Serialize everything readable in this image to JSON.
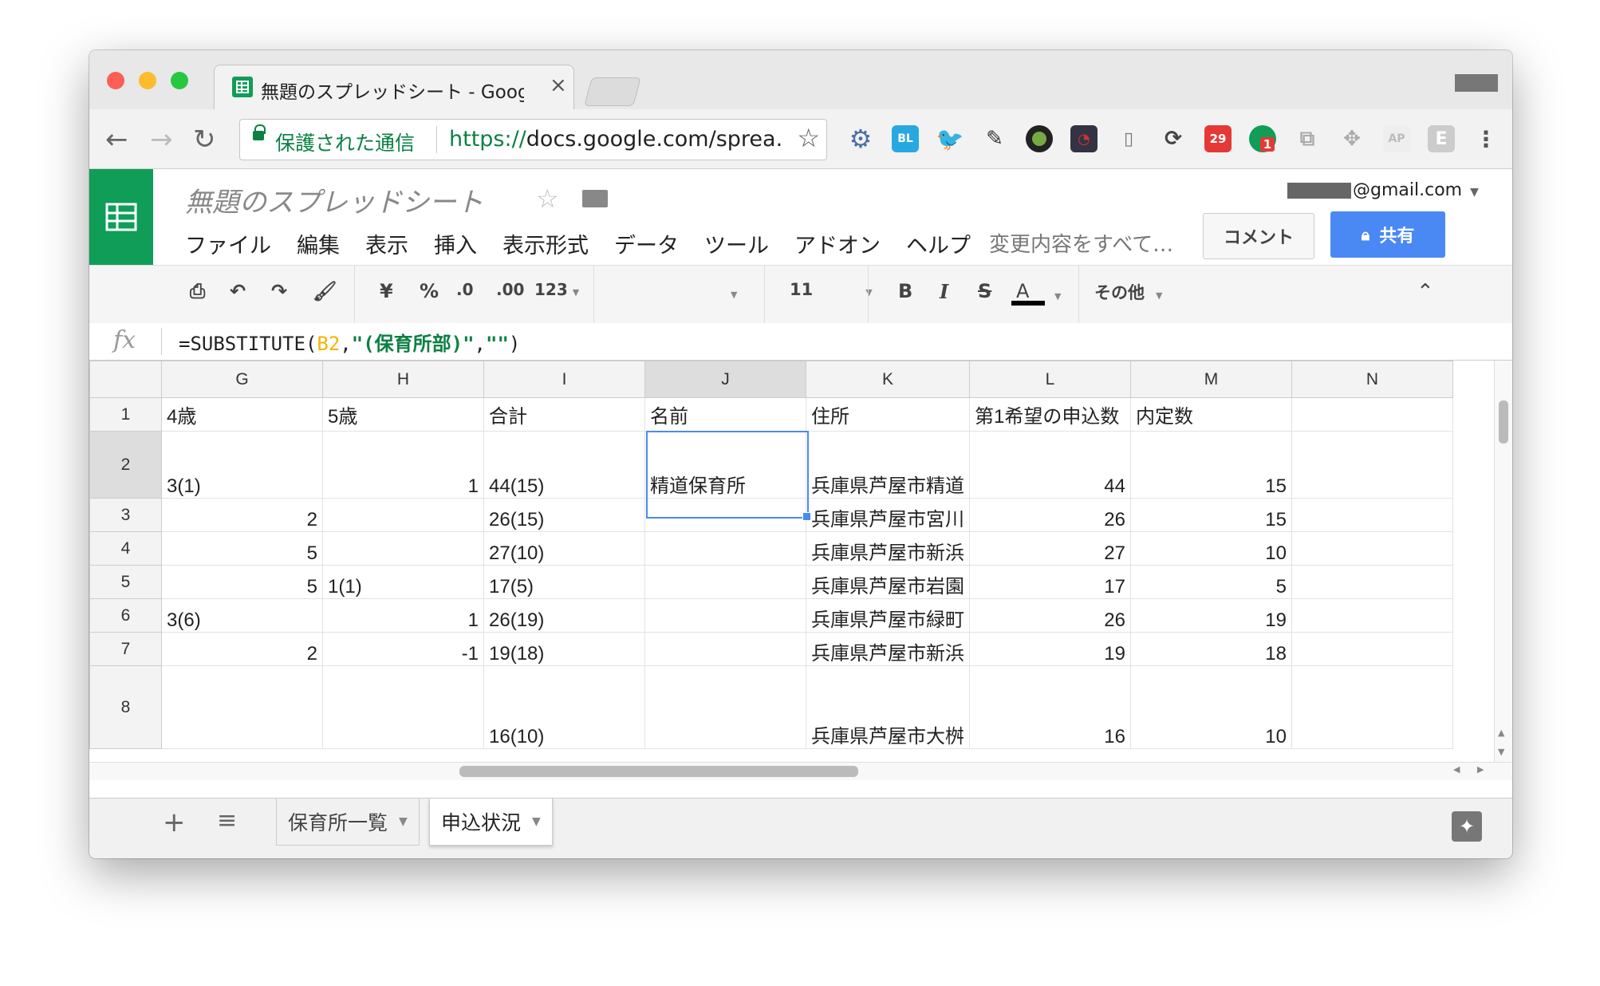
{
  "browser": {
    "tab_title": "無題のスプレッドシート - Google",
    "secure_label": "保護された通信",
    "url_scheme": "https://",
    "url_rest": "docs.google.com/sprea...",
    "ext_badge_calendar": "29",
    "ext_badge_green": "1",
    "ext_ap": "AP",
    "ext_e": "E",
    "ext_bl": "BL"
  },
  "doc": {
    "title": "無題のスプレッドシート",
    "menu": [
      "ファイル",
      "編集",
      "表示",
      "挿入",
      "表示形式",
      "データ",
      "ツール",
      "アドオン",
      "ヘルプ"
    ],
    "changes": "変更内容をすべて…",
    "email": "@gmail.com",
    "comment": "コメント",
    "share": "共有"
  },
  "toolbar": {
    "currency": "¥",
    "percent": "%",
    "dec_less": ".0",
    "dec_more": ".00",
    "format_123": "123",
    "font_size": "11",
    "bold": "B",
    "italic": "I",
    "strike": "S",
    "textcolor": "A",
    "more": "その他"
  },
  "formula": {
    "prefix": "=SUBSTITUTE(",
    "ref": "B2",
    "comma1": ",",
    "str1": "\"(保育所部)\"",
    "comma2": ",",
    "str2": "\"\"",
    "suffix": ")"
  },
  "sheet": {
    "columns": [
      "G",
      "H",
      "I",
      "J",
      "K",
      "L",
      "M",
      "N"
    ],
    "selected_column": "J",
    "rows": [
      {
        "num": "1",
        "cells": [
          "4歳",
          "5歳",
          "合計",
          "名前",
          "住所",
          "第1希望の申込数",
          "内定数",
          ""
        ]
      },
      {
        "num": "2",
        "cells": [
          "3(1)",
          "1",
          "44(15)",
          "精道保育所",
          "兵庫県芦屋市精道",
          "44",
          "15",
          ""
        ]
      },
      {
        "num": "3",
        "cells": [
          "2",
          "",
          "26(15)",
          "",
          "兵庫県芦屋市宮川",
          "26",
          "15",
          ""
        ]
      },
      {
        "num": "4",
        "cells": [
          "5",
          "",
          "27(10)",
          "",
          "兵庫県芦屋市新浜",
          "27",
          "10",
          ""
        ]
      },
      {
        "num": "5",
        "cells": [
          "5",
          "1(1)",
          "17(5)",
          "",
          "兵庫県芦屋市岩園",
          "17",
          "5",
          ""
        ]
      },
      {
        "num": "6",
        "cells": [
          "3(6)",
          "1",
          "26(19)",
          "",
          "兵庫県芦屋市緑町",
          "26",
          "19",
          ""
        ]
      },
      {
        "num": "7",
        "cells": [
          "2",
          "-1",
          "19(18)",
          "",
          "兵庫県芦屋市新浜",
          "19",
          "18",
          ""
        ]
      },
      {
        "num": "8",
        "cells": [
          "",
          "",
          "16(10)",
          "",
          "兵庫県芦屋市大桝",
          "16",
          "10",
          ""
        ]
      }
    ]
  },
  "sheet_tabs": [
    "保育所一覧",
    "申込状況"
  ],
  "active_sheet": "申込状況"
}
